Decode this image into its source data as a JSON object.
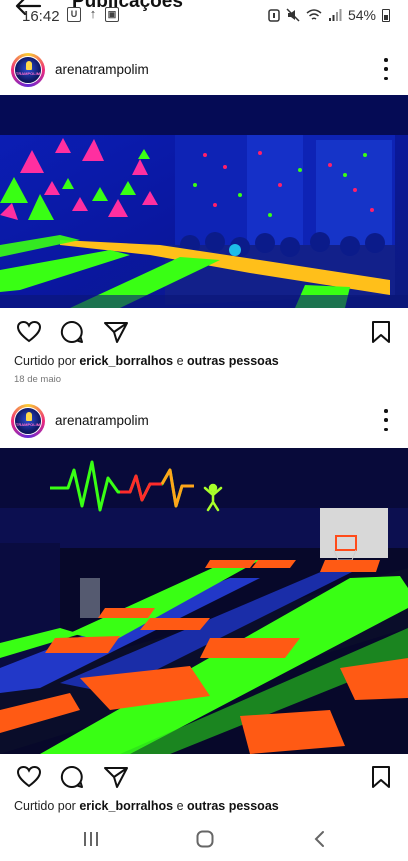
{
  "status_bar": {
    "time": "16:42",
    "battery": "54%",
    "left_icons": [
      "U",
      "↑",
      "▣"
    ]
  },
  "header": {
    "title": "Publicações"
  },
  "posts": [
    {
      "username": "arenatrampolim",
      "liked_by_prefix": "Curtido por ",
      "liked_by_user": "erick_borralhos",
      "liked_by_mid": " e ",
      "liked_by_suffix": "outras pessoas",
      "date": "18 de maio"
    },
    {
      "username": "arenatrampolim",
      "liked_by_prefix": "Curtido por ",
      "liked_by_user": "erick_borralhos",
      "liked_by_mid": " e ",
      "liked_by_suffix": "outras pessoas"
    }
  ],
  "avatar_logo_text": "TRAMPOLIM",
  "icons": [
    "back-arrow-icon",
    "like-heart-icon",
    "comment-icon",
    "share-icon",
    "save-icon",
    "more-options-icon",
    "recent-apps-icon",
    "home-icon",
    "back-icon"
  ]
}
